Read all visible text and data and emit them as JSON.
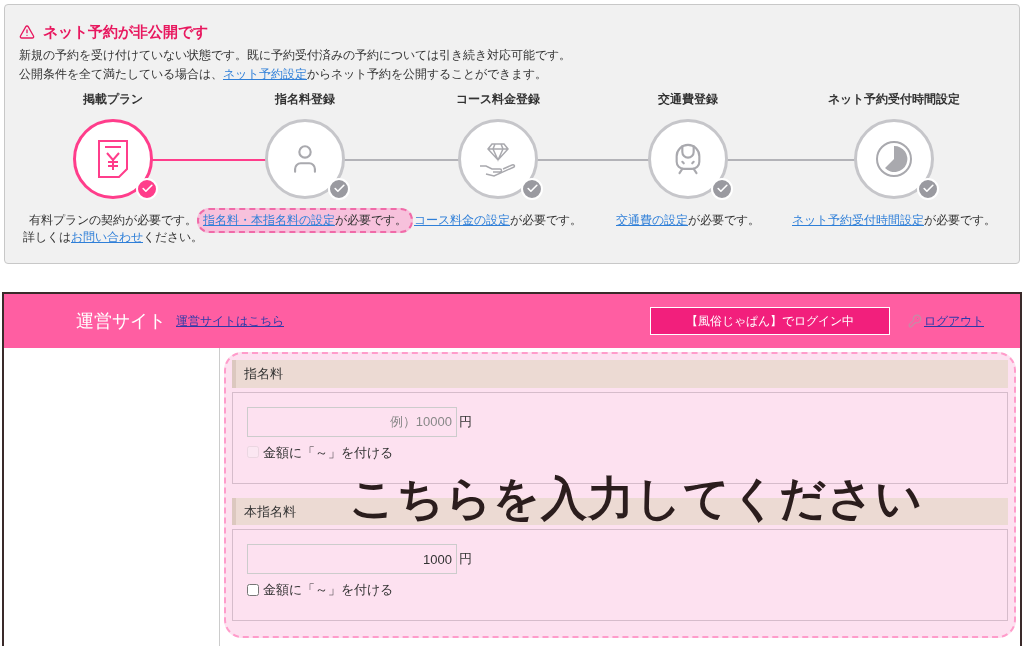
{
  "notice": {
    "title": "ネット予約が非公開です",
    "lines": [
      [
        {
          "text": "新規の予約を受け付けていない状態です。既に予約受付済みの予約については引き続き対応可能です。",
          "link": false
        }
      ],
      [
        {
          "text": "公開条件を全て満たしている場合は、",
          "link": false
        },
        {
          "text": "ネット予約設定",
          "link": true
        },
        {
          "text": "からネット予約を公開することができます。",
          "link": false
        }
      ]
    ]
  },
  "steps": [
    {
      "title": "掲載プラン",
      "kind": "receipt",
      "complete": true,
      "highlighted": false,
      "note": [
        [
          {
            "text": "有料プランの契約が必要です。",
            "link": false
          }
        ],
        [
          {
            "text": "詳しくは",
            "link": false
          },
          {
            "text": "お問い合わせ",
            "link": true
          },
          {
            "text": "ください。",
            "link": false
          }
        ]
      ]
    },
    {
      "title": "指名料登録",
      "kind": "person",
      "complete": false,
      "highlighted": true,
      "note": [
        [
          {
            "text": "指名料・本指名料の設定",
            "link": true
          },
          {
            "text": "が必要です。",
            "link": false
          }
        ]
      ]
    },
    {
      "title": "コース料金登録",
      "kind": "gem",
      "complete": false,
      "highlighted": false,
      "note": [
        [
          {
            "text": "コース料金の設定",
            "link": true
          },
          {
            "text": "が必要です。",
            "link": false
          }
        ]
      ]
    },
    {
      "title": "交通費登録",
      "kind": "train",
      "complete": false,
      "highlighted": false,
      "note": [
        [
          {
            "text": "交通費の設定",
            "link": true
          },
          {
            "text": "が必要です。",
            "link": false
          }
        ]
      ]
    },
    {
      "title": "ネット予約受付時間設定",
      "kind": "clock",
      "complete": false,
      "highlighted": false,
      "note": [
        [
          {
            "text": "ネット予約受付時間設定",
            "link": true
          },
          {
            "text": "が必要です。",
            "link": false
          }
        ]
      ]
    }
  ],
  "header": {
    "title": "運営サイト",
    "link": "運営サイトはこちら",
    "login_status": "【風俗じゃぱん】でログイン中",
    "logout": "ログアウト"
  },
  "sections": [
    {
      "heading": "指名料",
      "placeholder": "例）10000",
      "unit": "円",
      "checkbox": {
        "label": "金額に「～」を付ける",
        "checked": false,
        "disabled": true
      }
    },
    {
      "heading": "本指名料",
      "value": "1000",
      "unit": "円",
      "checkbox": {
        "label": "金額に「～」を付ける",
        "checked": false,
        "disabled": false
      }
    }
  ],
  "callout": "こちらを入力してください"
}
